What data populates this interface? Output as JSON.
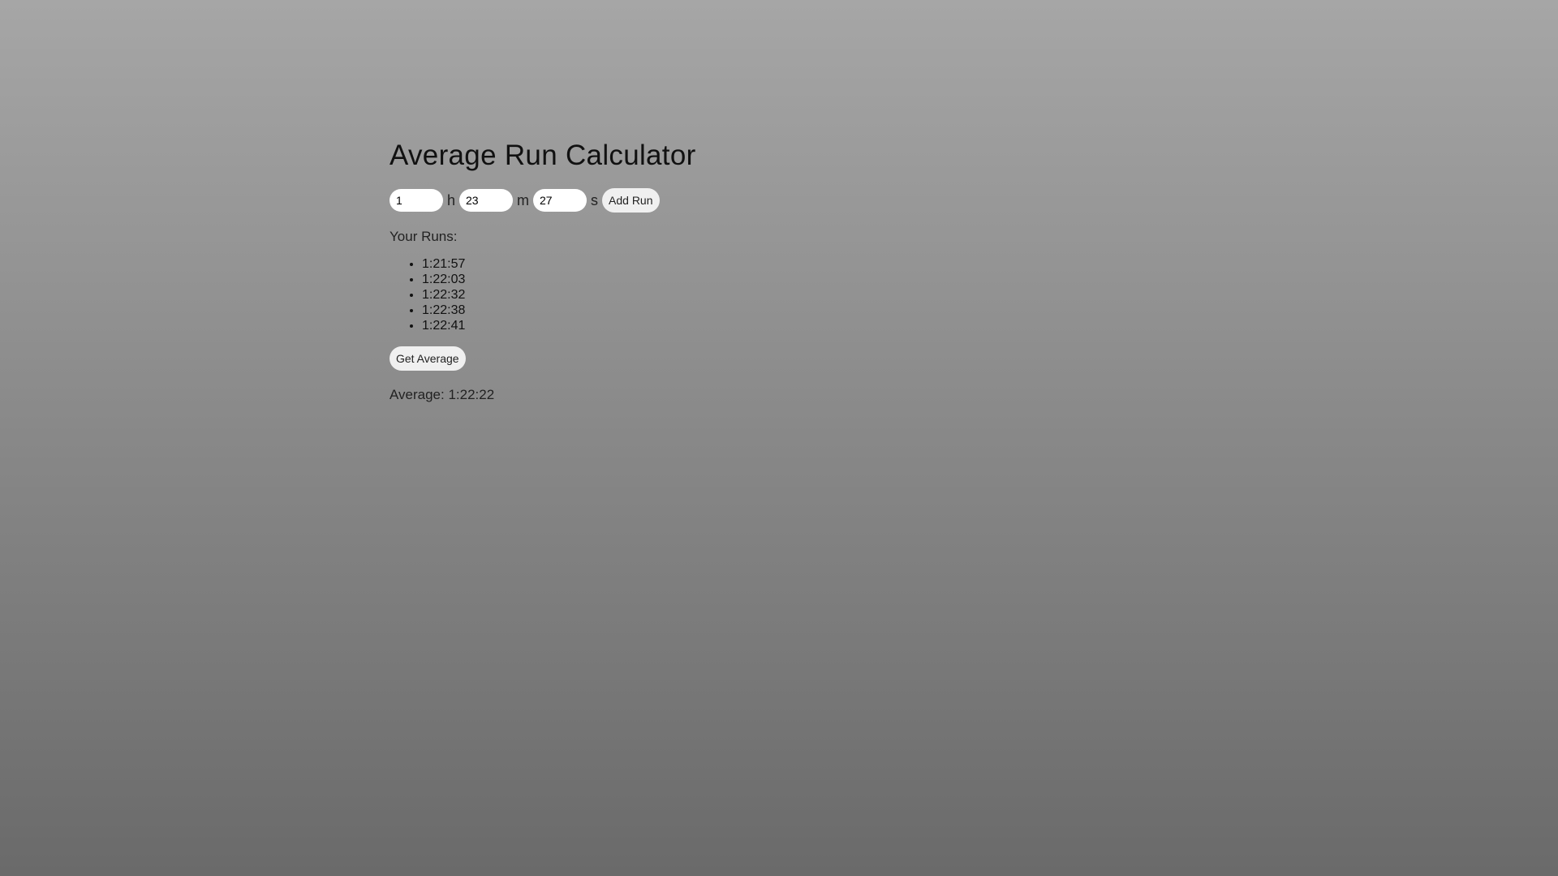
{
  "title": "Average Run Calculator",
  "inputs": {
    "hours": "1",
    "minutes": "23",
    "seconds": "27"
  },
  "units": {
    "h": "h",
    "m": "m",
    "s": "s"
  },
  "add_run_label": "Add Run",
  "runs_label": "Your Runs:",
  "runs": [
    "1:21:57",
    "1:22:03",
    "1:22:32",
    "1:22:38",
    "1:22:41"
  ],
  "get_average_label": "Get Average",
  "average_text": "Average: 1:22:22"
}
